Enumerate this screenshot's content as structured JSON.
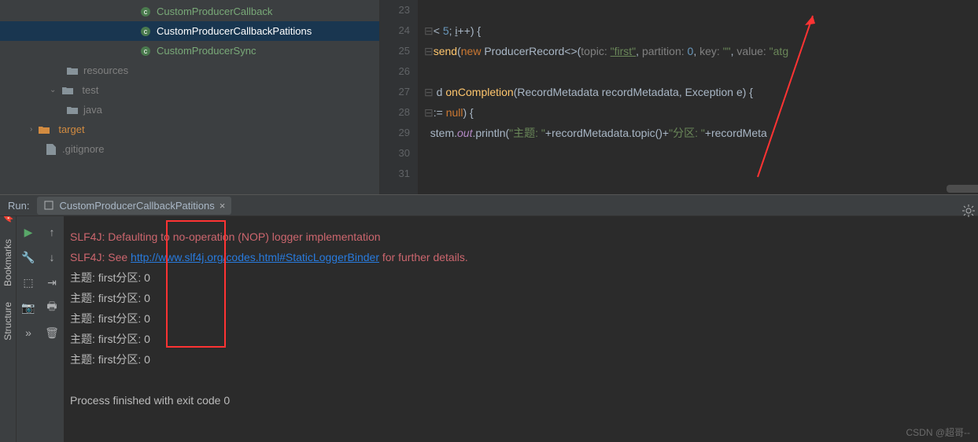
{
  "tree": {
    "items": [
      {
        "label": "CustomProducerCallback",
        "type": "class",
        "indent": "i1"
      },
      {
        "label": "CustomProducerCallbackPatitions",
        "type": "class",
        "indent": "i1",
        "selected": true
      },
      {
        "label": "CustomProducerSync",
        "type": "class",
        "indent": "i1"
      },
      {
        "label": "resources",
        "type": "folder",
        "indent": "i3",
        "chev": ""
      },
      {
        "label": "test",
        "type": "folder",
        "indent": "i2",
        "chev": "⌄"
      },
      {
        "label": "java",
        "type": "folder",
        "indent": "i3",
        "chev": ""
      },
      {
        "label": "target",
        "type": "dir",
        "indent": "i4",
        "chev": "›"
      },
      {
        "label": ".gitignore",
        "type": "file",
        "indent": "i5",
        "chev": ""
      }
    ]
  },
  "gutter": [
    "23",
    "24",
    "25",
    "26",
    "27",
    "28",
    "29",
    "30",
    "31"
  ],
  "code": {
    "l23": "",
    "l24": {
      "p1": "< ",
      "n1": "5",
      "p2": "; ",
      "v": "i",
      "p3": "++) {"
    },
    "l25": {
      "m": "send",
      "p1": "(",
      "kw": "new",
      "p2": " ProducerRecord<>(",
      "pn1": "topic:",
      "sp": " ",
      "s1": "\"first\"",
      "c1": ", ",
      "pn2": "partition:",
      "n": "0",
      "c2": ", ",
      "pn3": "key:",
      "s2": "\"\"",
      "c3": ", ",
      "pn4": "value:",
      "s3": "\"atg"
    },
    "l26": "",
    "l27": {
      "p1": "d ",
      "m": "onCompletion",
      "p2": "(RecordMetadata recordMetadata, Exception e) {"
    },
    "l28": {
      "p1": ":= ",
      "kw": "null",
      "p2": ") {"
    },
    "l29": {
      "p1": "stem.",
      "f": "out",
      "p2": ".println(",
      "s1": "\"主题:  \"",
      "p3": "+recordMetadata.topic()+",
      "s2": "\"分区:  \"",
      "p4": "+recordMeta"
    },
    "l30": ""
  },
  "run": {
    "label": "Run:",
    "tab": "CustomProducerCallbackPatitions"
  },
  "console": {
    "l1": "SLF4J: Defaulting to no-operation (NOP) logger implementation",
    "l2a": "SLF4J: See ",
    "l2b": "http://www.slf4j.org/codes.html#StaticLoggerBinder",
    "l2c": " for further details.",
    "out": "主题:  first分区:  0",
    "exit": "Process finished with exit code 0"
  },
  "sidebar": {
    "t1": "Bookmarks",
    "t2": "Structure"
  },
  "wm": "CSDN @超哥--"
}
